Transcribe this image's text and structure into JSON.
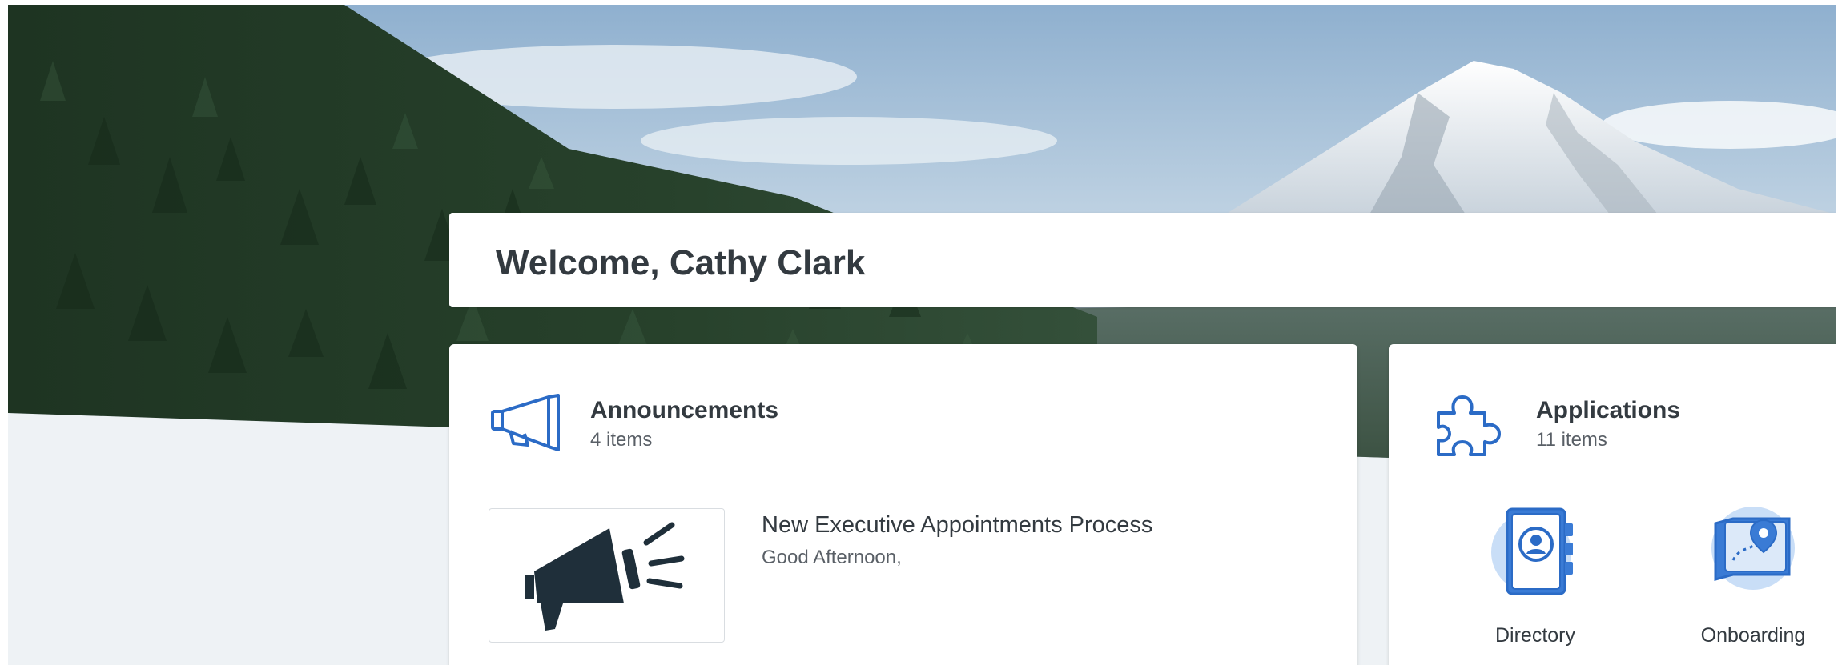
{
  "welcome": {
    "title": "Welcome, Cathy Clark"
  },
  "announcements": {
    "title": "Announcements",
    "count": "4 items",
    "items": [
      {
        "title": "New Executive Appointments Process",
        "snippet": "Good Afternoon,",
        "thumbnail_icon": "megaphone-icon"
      }
    ],
    "icon": "megaphone-icon"
  },
  "applications": {
    "title": "Applications",
    "count": "11 items",
    "icon": "puzzle-piece-icon",
    "items": [
      {
        "label": "Directory",
        "icon": "address-book-icon"
      },
      {
        "label": "Onboarding",
        "icon": "map-location-icon"
      }
    ]
  },
  "colors": {
    "accent_blue": "#2b6bc6",
    "light_blue": "#c9def7",
    "dark_icon": "#1f2f3a",
    "page_bg": "#eef2f5"
  }
}
